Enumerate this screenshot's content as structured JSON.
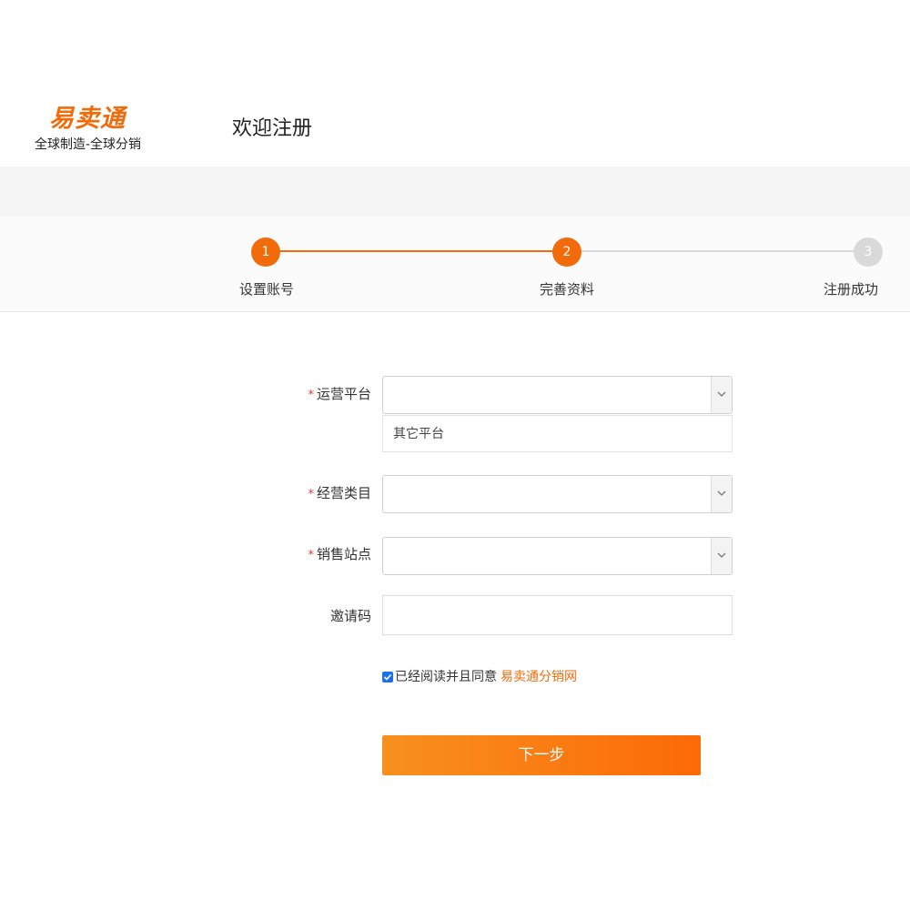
{
  "header": {
    "logo_text": "易卖通",
    "slogan": "全球制造-全球分销",
    "title": "欢迎注册"
  },
  "steps": [
    {
      "number": "1",
      "label": "设置账号",
      "state": "done"
    },
    {
      "number": "2",
      "label": "完善资料",
      "state": "active"
    },
    {
      "number": "3",
      "label": "注册成功",
      "state": "pending"
    }
  ],
  "form": {
    "platform": {
      "label": "运营平台",
      "required_mark": "*",
      "value": "",
      "dropdown_option": "其它平台"
    },
    "category": {
      "label": "经营类目",
      "required_mark": "*",
      "value": ""
    },
    "site": {
      "label": "销售站点",
      "required_mark": "*",
      "value": ""
    },
    "invite": {
      "label": "邀请码",
      "value": ""
    },
    "agree": {
      "checked": true,
      "text": "已经阅读并且同意",
      "link_text": "易卖通分销网"
    },
    "next_label": "下一步"
  },
  "colors": {
    "accent": "#f26b0a",
    "required": "#e4393c",
    "checkbox": "#1f6fe6",
    "inactive_step": "#d9d9d9"
  }
}
